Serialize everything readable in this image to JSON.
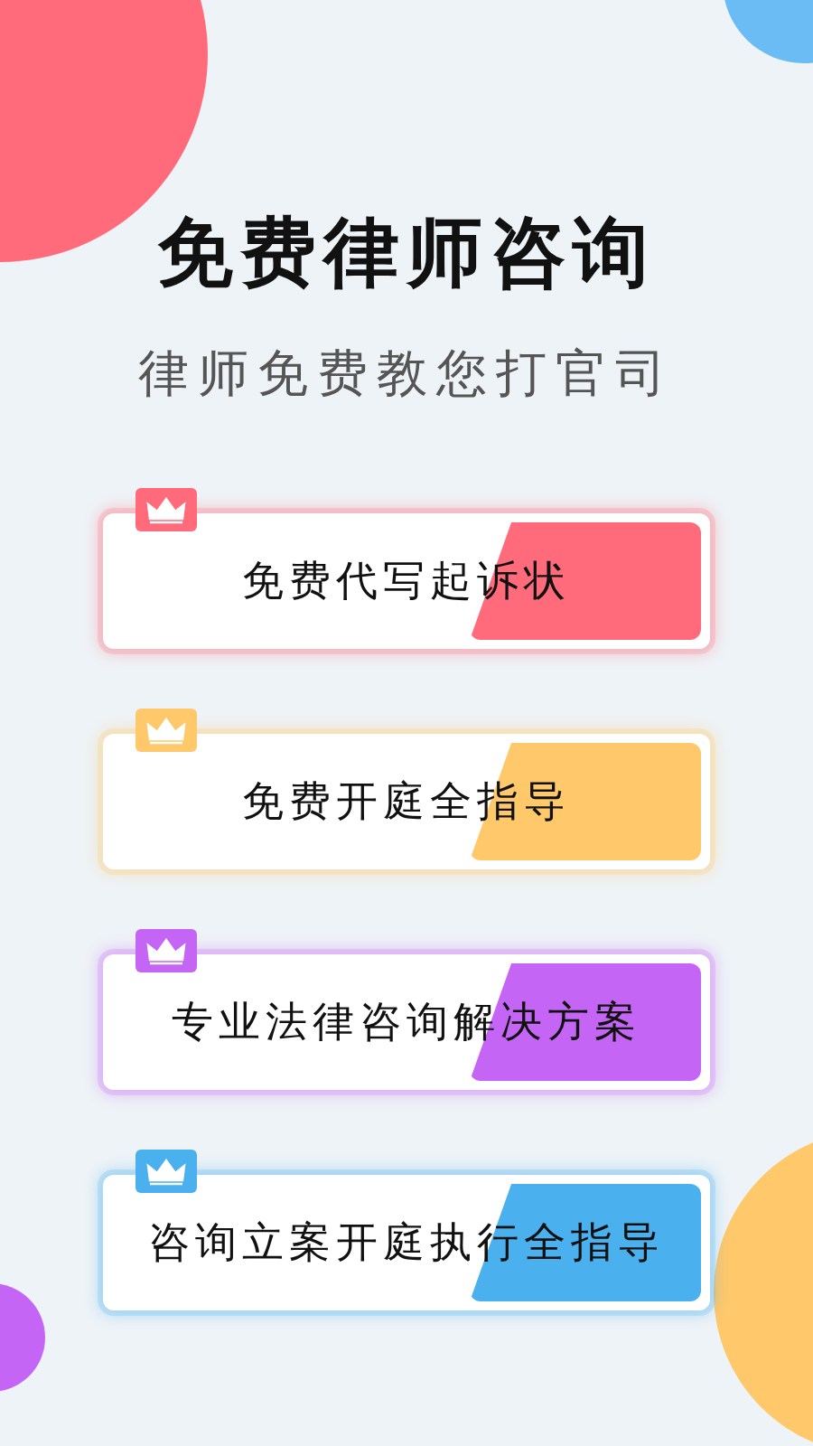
{
  "title": "免费律师咨询",
  "subtitle": "律师免费教您打官司",
  "cards": [
    {
      "label": "免费代写起诉状",
      "color": "#ff6b7a"
    },
    {
      "label": "免费开庭全指导",
      "color": "#ffc86b"
    },
    {
      "label": "专业法律咨询解决方案",
      "color": "#c565f5"
    },
    {
      "label": "咨询立案开庭执行全指导",
      "color": "#4ab0ee"
    }
  ]
}
